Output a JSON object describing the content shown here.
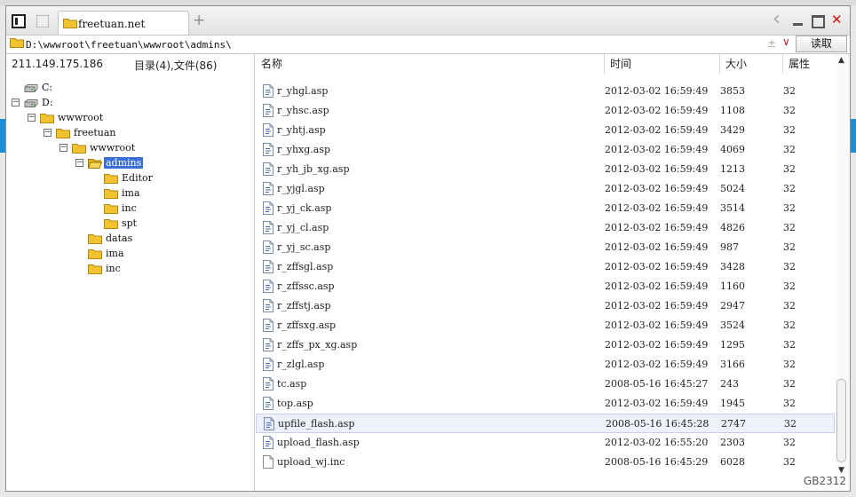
{
  "tab": {
    "title": "freetuan.net",
    "new_tab": "+"
  },
  "path": {
    "value": "D:\\wwwroot\\freetuan\\wwwroot\\admins\\",
    "plusminus": "±",
    "dropdown": "∨"
  },
  "read_button": "读取",
  "left": {
    "ip": "211.149.175.186",
    "dir_count": "目录(4),文件(86)",
    "tree": [
      {
        "label": "C:",
        "type": "drive",
        "level": 0,
        "expander": ""
      },
      {
        "label": "D:",
        "type": "drive",
        "level": 0,
        "expander": "−"
      },
      {
        "label": "wwwroot",
        "type": "folder",
        "level": 1,
        "expander": "−"
      },
      {
        "label": "freetuan",
        "type": "folder",
        "level": 2,
        "expander": "−"
      },
      {
        "label": "wwwroot",
        "type": "folder",
        "level": 3,
        "expander": "−"
      },
      {
        "label": "admins",
        "type": "folder-open",
        "level": 4,
        "expander": "−",
        "selected": true
      },
      {
        "label": "Editor",
        "type": "folder",
        "level": 5,
        "expander": ""
      },
      {
        "label": "ima",
        "type": "folder",
        "level": 5,
        "expander": ""
      },
      {
        "label": "inc",
        "type": "folder",
        "level": 5,
        "expander": ""
      },
      {
        "label": "spt",
        "type": "folder",
        "level": 5,
        "expander": ""
      },
      {
        "label": "datas",
        "type": "folder",
        "level": 4,
        "expander": ""
      },
      {
        "label": "ima",
        "type": "folder",
        "level": 4,
        "expander": ""
      },
      {
        "label": "inc",
        "type": "folder",
        "level": 4,
        "expander": ""
      }
    ]
  },
  "columns": {
    "name": "名称",
    "time": "时间",
    "size": "大小",
    "attr": "属性"
  },
  "files": [
    {
      "name": "r_yhgl.asp",
      "time": "2012-03-02 16:59:49",
      "size": "3853",
      "attr": "32",
      "icon": "asp"
    },
    {
      "name": "r_yhsc.asp",
      "time": "2012-03-02 16:59:49",
      "size": "1108",
      "attr": "32",
      "icon": "asp"
    },
    {
      "name": "r_yhtj.asp",
      "time": "2012-03-02 16:59:49",
      "size": "3429",
      "attr": "32",
      "icon": "asp"
    },
    {
      "name": "r_yhxg.asp",
      "time": "2012-03-02 16:59:49",
      "size": "4069",
      "attr": "32",
      "icon": "asp"
    },
    {
      "name": "r_yh_jb_xg.asp",
      "time": "2012-03-02 16:59:49",
      "size": "1213",
      "attr": "32",
      "icon": "asp"
    },
    {
      "name": "r_yjgl.asp",
      "time": "2012-03-02 16:59:49",
      "size": "5024",
      "attr": "32",
      "icon": "asp"
    },
    {
      "name": "r_yj_ck.asp",
      "time": "2012-03-02 16:59:49",
      "size": "3514",
      "attr": "32",
      "icon": "asp"
    },
    {
      "name": "r_yj_cl.asp",
      "time": "2012-03-02 16:59:49",
      "size": "4826",
      "attr": "32",
      "icon": "asp"
    },
    {
      "name": "r_yj_sc.asp",
      "time": "2012-03-02 16:59:49",
      "size": "987",
      "attr": "32",
      "icon": "asp"
    },
    {
      "name": "r_zffsgl.asp",
      "time": "2012-03-02 16:59:49",
      "size": "3428",
      "attr": "32",
      "icon": "asp"
    },
    {
      "name": "r_zffssc.asp",
      "time": "2012-03-02 16:59:49",
      "size": "1160",
      "attr": "32",
      "icon": "asp"
    },
    {
      "name": "r_zffstj.asp",
      "time": "2012-03-02 16:59:49",
      "size": "2947",
      "attr": "32",
      "icon": "asp"
    },
    {
      "name": "r_zffsxg.asp",
      "time": "2012-03-02 16:59:49",
      "size": "3524",
      "attr": "32",
      "icon": "asp"
    },
    {
      "name": "r_zffs_px_xg.asp",
      "time": "2012-03-02 16:59:49",
      "size": "1295",
      "attr": "32",
      "icon": "asp"
    },
    {
      "name": "r_zlgl.asp",
      "time": "2012-03-02 16:59:49",
      "size": "3166",
      "attr": "32",
      "icon": "asp"
    },
    {
      "name": "tc.asp",
      "time": "2008-05-16 16:45:27",
      "size": "243",
      "attr": "32",
      "icon": "asp"
    },
    {
      "name": "top.asp",
      "time": "2012-03-02 16:59:49",
      "size": "1945",
      "attr": "32",
      "icon": "asp"
    },
    {
      "name": "upfile_flash.asp",
      "time": "2008-05-16 16:45:28",
      "size": "2747",
      "attr": "32",
      "icon": "asp",
      "highlight": true
    },
    {
      "name": "upload_flash.asp",
      "time": "2012-03-02 16:55:20",
      "size": "2303",
      "attr": "32",
      "icon": "asp"
    },
    {
      "name": "upload_wj.inc",
      "time": "2008-05-16 16:45:29",
      "size": "6028",
      "attr": "32",
      "icon": "inc"
    }
  ],
  "encoding": "GB2312",
  "colors": {
    "selected": "#3a6fd8",
    "folder": "#f2c230",
    "close": "#d01010"
  }
}
